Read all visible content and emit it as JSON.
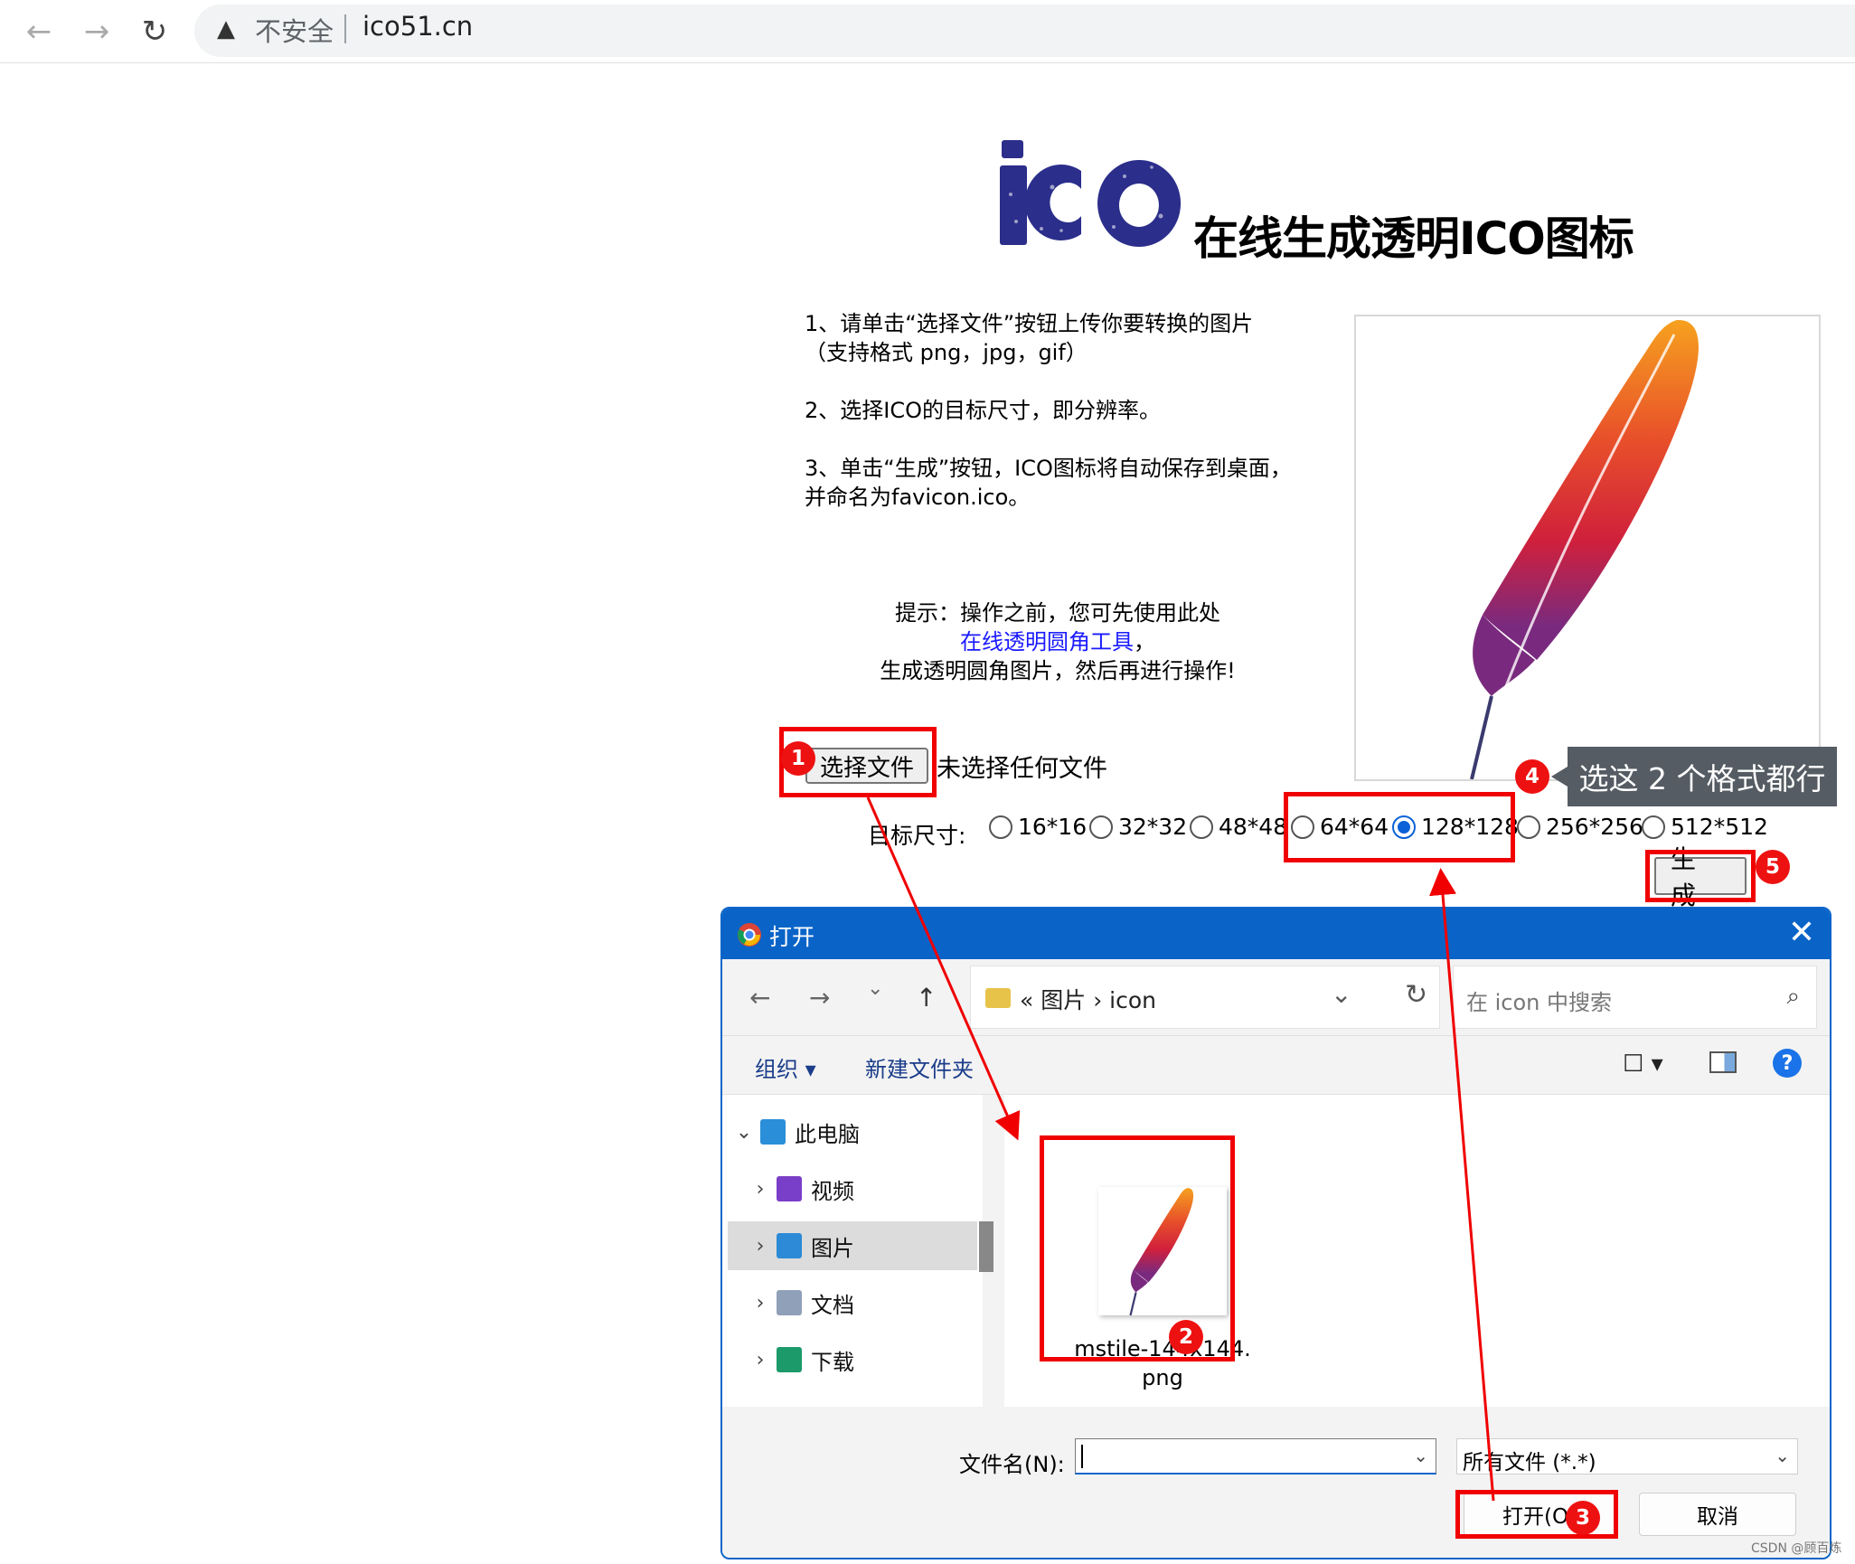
{
  "browser": {
    "insecure_label": "不安全",
    "url": "ico51.cn",
    "warn_glyph": "▲",
    "back_glyph": "←",
    "forward_glyph": "→",
    "reload_glyph": "↻"
  },
  "page": {
    "title": "在线生成透明ICO图标",
    "steps": [
      "1、请单击“选择文件”按钮上传你要转换的图片",
      "（支持格式 png，jpg，gif）",
      "2、选择ICO的目标尺寸，即分辨率。",
      "3、单击“生成”按钮，ICO图标将自动保存到桌面，",
      "并命名为favicon.ico。"
    ],
    "tip_line1": "提示：操作之前，您可先使用此处",
    "tip_link": "在线透明圆角工具",
    "tip_comma": "，",
    "tip_line3": "生成透明圆角图片，然后再进行操作!",
    "choose_file": "选择文件",
    "no_file": "未选择任何文件",
    "size_label": "目标尺寸:",
    "sizes": [
      "16*16",
      "32*32",
      "48*48",
      "64*64",
      "128*128",
      "256*256",
      "512*512"
    ],
    "generate": "生 成"
  },
  "annotations": {
    "badges": [
      "1",
      "2",
      "3",
      "4",
      "5"
    ],
    "callout": "选这 2 个格式都行"
  },
  "dialog": {
    "title": "打开",
    "close_glyph": "✕",
    "nav": {
      "back": "←",
      "forward": "→",
      "recent": "⌄",
      "up": "↑"
    },
    "breadcrumb": "«  图片  ›  icon",
    "breadcrumb_drop": "⌄",
    "refresh": "↻",
    "search_placeholder": "在 icon 中搜索",
    "search_glyph": "⌕",
    "organize": "组织 ▾",
    "new_folder": "新建文件夹",
    "view_glyph": "☐ ▾",
    "help": "?",
    "tree": [
      {
        "chevron": "⌄",
        "label": "此电脑",
        "color": "#2a8fd8"
      },
      {
        "chevron": "›",
        "label": "视频",
        "color": "#7a3fc8"
      },
      {
        "chevron": "›",
        "label": "图片",
        "color": "#2c8ad6"
      },
      {
        "chevron": "›",
        "label": "文档",
        "color": "#8fa0b8"
      },
      {
        "chevron": "›",
        "label": "下载",
        "color": "#1c9a6a"
      }
    ],
    "file_name_line1": "mstile-144x144.",
    "file_name_line2": "png",
    "filename_label": "文件名(N):",
    "filename_value": "",
    "filetype": "所有文件 (*.*)",
    "dropdown_glyph": "⌄",
    "open": "打开(O)",
    "cancel": "取消"
  },
  "watermark": "CSDN @顾百炼",
  "colors": {
    "accent": "#0a64c8",
    "annotation_red": "#f00000",
    "logo_navy": "#2b2e8a",
    "link": "#1a1aff"
  }
}
